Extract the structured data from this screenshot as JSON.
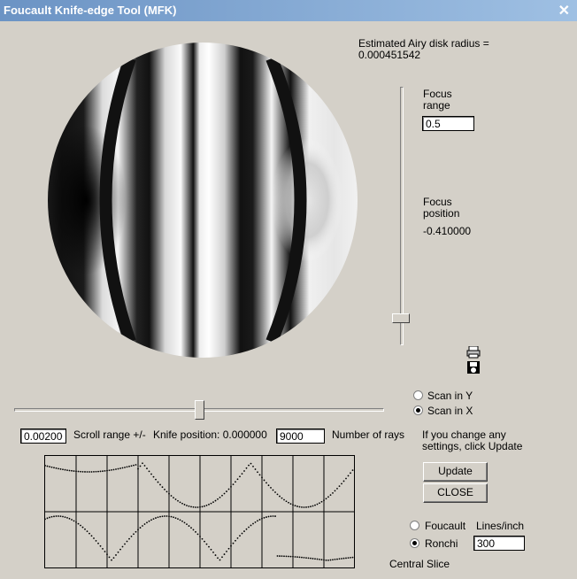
{
  "window": {
    "title": "Foucault Knife-edge Tool (MFK)",
    "close_glyph": "✕"
  },
  "airy": {
    "label": "Estimated Airy disk radius =",
    "value": "0.000451542"
  },
  "focus_range": {
    "label_line1": "Focus",
    "label_line2": "range",
    "value": "0.5"
  },
  "focus_position": {
    "label_line1": "Focus",
    "label_line2": "position",
    "value": "-0.410000"
  },
  "scan": {
    "y_label": "Scan in Y",
    "x_label": "Scan in X",
    "selected": "x"
  },
  "controls": {
    "scroll_value": "0.002000",
    "scroll_label": "Scroll range +/-",
    "knife_label": "Knife position: 0.000000",
    "rays_value": "9000",
    "rays_label": "Number of rays"
  },
  "update_hint": {
    "line1": "If you change any",
    "line2": "settings, click Update"
  },
  "buttons": {
    "update": "Update",
    "close": "CLOSE"
  },
  "mode": {
    "foucault_label": "Foucault",
    "ronchi_label": "Ronchi",
    "selected": "ronchi",
    "lines_label": "Lines/inch",
    "lines_value": "300"
  },
  "central_slice_label": "Central Slice",
  "icons": {
    "printer": "printer-icon",
    "save": "disk-save-icon"
  }
}
